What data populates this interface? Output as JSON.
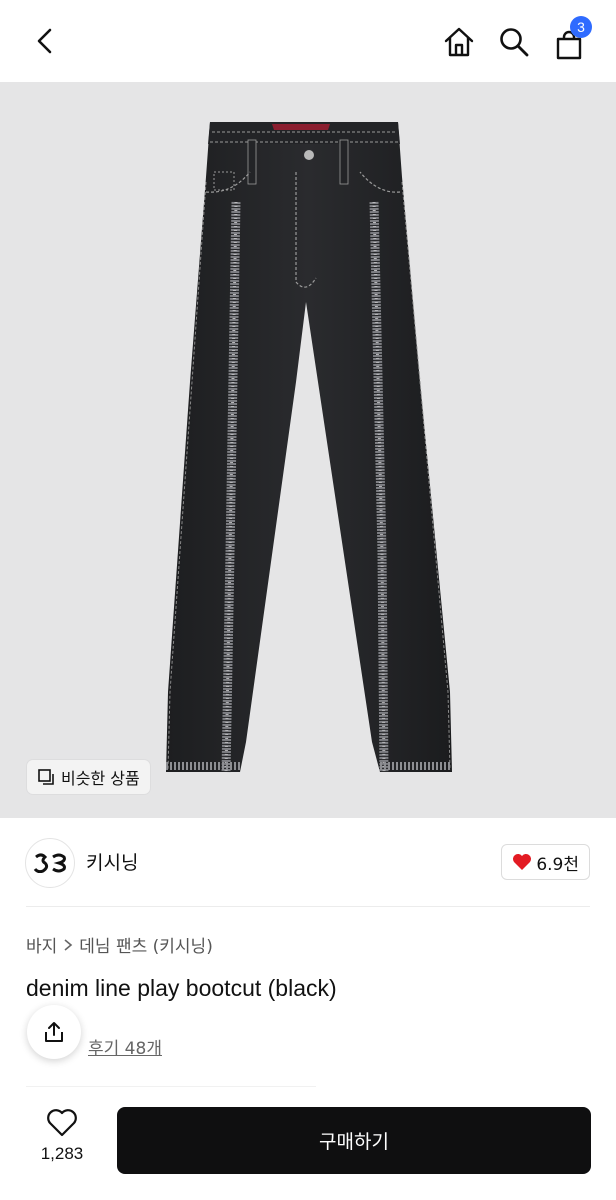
{
  "header": {
    "back_icon": "chevron-left-icon",
    "home_icon": "home-icon",
    "search_icon": "search-icon",
    "cart_icon": "shopping-bag-icon",
    "cart_count": "3",
    "badge_color": "#2f6bff"
  },
  "hero": {
    "image": "black bootcut denim pants with frayed vertical seam lines",
    "similar_products_label": "비슷한 상품"
  },
  "brand": {
    "name": "키시닝",
    "logo_text": "S3",
    "likes": "6.9천",
    "heart_color": "#e31b23"
  },
  "product": {
    "breadcrumb": [
      "바지",
      "데님 팬츠 (키시닝)"
    ],
    "title": "denim line play bootcut (black)",
    "review_label": "후기 48개"
  },
  "bottom": {
    "wish_count": "1,283",
    "buy_label": "구매하기"
  }
}
